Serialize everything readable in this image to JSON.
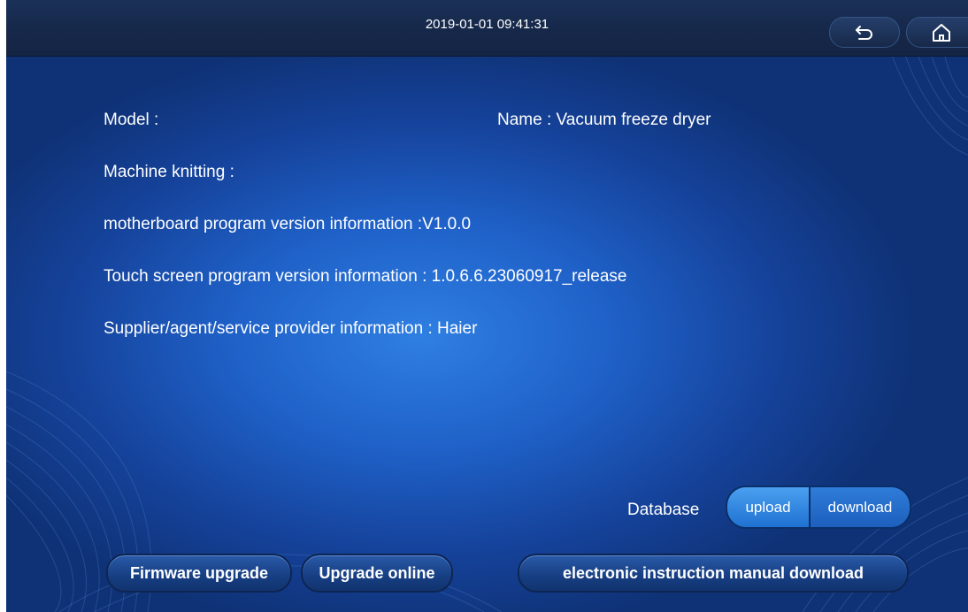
{
  "statusbar": {
    "datetime": "2019-01-01 09:41:31",
    "back_icon": "back-arrow-icon",
    "home_icon": "home-icon"
  },
  "info": {
    "model": "Model :",
    "name": "Name : Vacuum freeze dryer",
    "machine_knitting": "Machine knitting :",
    "motherboard": "motherboard program version information :V1.0.0",
    "touchscreen": "Touch screen program version information : 1.0.6.6.23060917_release",
    "supplier": "Supplier/agent/service provider information : Haier"
  },
  "database": {
    "label": "Database",
    "upload": "upload",
    "download": "download"
  },
  "actions": {
    "firmware_upgrade": "Firmware upgrade",
    "upgrade_online": "Upgrade online",
    "manual_download": "electronic instruction manual download"
  },
  "colors": {
    "background_center": "#2f7fe2",
    "background_edge": "#0f3276",
    "topbar": "#16284a",
    "text": "#ffffff"
  }
}
